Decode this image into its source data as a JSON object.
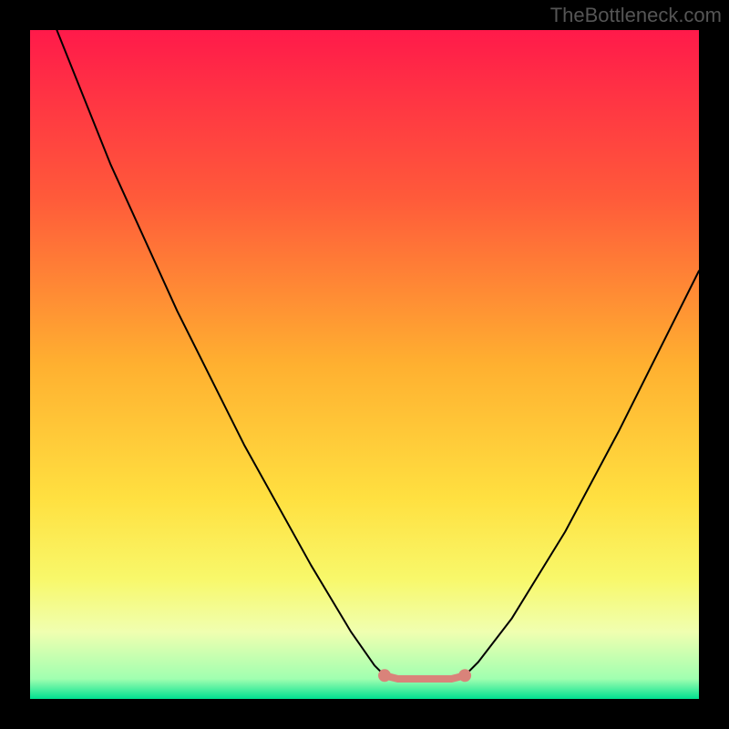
{
  "watermark": "TheBottleneck.com",
  "chart_data": {
    "type": "line",
    "title": "",
    "xlabel": "",
    "ylabel": "",
    "xlim": [
      0,
      100
    ],
    "ylim": [
      0,
      100
    ],
    "background_gradient": {
      "stops": [
        {
          "offset": 0.0,
          "color": "#ff1a4a"
        },
        {
          "offset": 0.25,
          "color": "#ff5a3a"
        },
        {
          "offset": 0.5,
          "color": "#ffb030"
        },
        {
          "offset": 0.7,
          "color": "#ffe040"
        },
        {
          "offset": 0.82,
          "color": "#f8f86a"
        },
        {
          "offset": 0.9,
          "color": "#f0ffb0"
        },
        {
          "offset": 0.97,
          "color": "#a0ffb0"
        },
        {
          "offset": 1.0,
          "color": "#00e090"
        }
      ]
    },
    "series": [
      {
        "name": "bottleneck-curve-left",
        "type": "line",
        "color": "#000000",
        "width": 2,
        "points": [
          {
            "x": 4.0,
            "y": 100.0
          },
          {
            "x": 12.0,
            "y": 80.0
          },
          {
            "x": 22.0,
            "y": 58.0
          },
          {
            "x": 32.0,
            "y": 38.0
          },
          {
            "x": 42.0,
            "y": 20.0
          },
          {
            "x": 48.0,
            "y": 10.0
          },
          {
            "x": 51.5,
            "y": 5.0
          },
          {
            "x": 53.0,
            "y": 3.5
          }
        ]
      },
      {
        "name": "bottleneck-curve-right",
        "type": "line",
        "color": "#000000",
        "width": 2,
        "points": [
          {
            "x": 65.0,
            "y": 3.5
          },
          {
            "x": 67.0,
            "y": 5.5
          },
          {
            "x": 72.0,
            "y": 12.0
          },
          {
            "x": 80.0,
            "y": 25.0
          },
          {
            "x": 88.0,
            "y": 40.0
          },
          {
            "x": 95.0,
            "y": 54.0
          },
          {
            "x": 100.0,
            "y": 64.0
          }
        ]
      },
      {
        "name": "optimal-flat",
        "type": "line",
        "color": "#d9837a",
        "width": 8,
        "points": [
          {
            "x": 53.0,
            "y": 3.5
          },
          {
            "x": 55.0,
            "y": 3.0
          },
          {
            "x": 60.0,
            "y": 3.0
          },
          {
            "x": 63.0,
            "y": 3.0
          },
          {
            "x": 65.0,
            "y": 3.5
          }
        ]
      }
    ],
    "markers": [
      {
        "x": 53.0,
        "y": 3.5,
        "color": "#d9837a",
        "size": 7
      },
      {
        "x": 65.0,
        "y": 3.5,
        "color": "#d9837a",
        "size": 7
      }
    ]
  }
}
